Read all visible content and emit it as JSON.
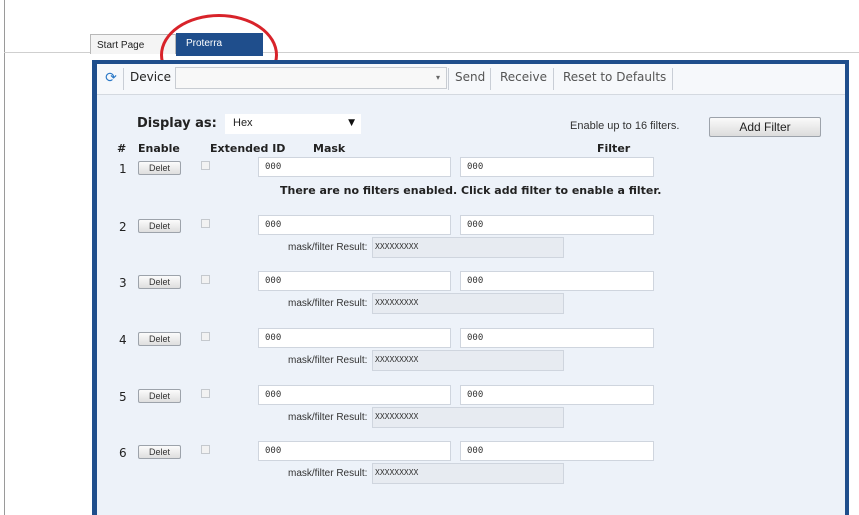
{
  "tabs": [
    {
      "label": "Start Page"
    },
    {
      "label": "Proterra"
    }
  ],
  "toolbar": {
    "device_label": "Device",
    "device_value": "",
    "send_label": "Send",
    "receive_label": "Receive",
    "reset_label": "Reset to Defaults"
  },
  "display": {
    "label": "Display as:",
    "selected": "Hex"
  },
  "enable_note": "Enable up to 16 filters.",
  "add_filter_label": "Add Filter",
  "columns": {
    "number": "#",
    "enable": "Enable",
    "extended_id": "Extended ID",
    "mask": "Mask",
    "filter": "Filter"
  },
  "no_filters_message": "There are no filters enabled. Click add filter to enable a filter.",
  "result_label": "mask/filter Result:",
  "rows": [
    {
      "num": "1",
      "delete_label": "Delet",
      "mask": "000",
      "filter": "000",
      "result": ""
    },
    {
      "num": "2",
      "delete_label": "Delet",
      "mask": "000",
      "filter": "000",
      "result": "XXXXXXXXX"
    },
    {
      "num": "3",
      "delete_label": "Delet",
      "mask": "000",
      "filter": "000",
      "result": "XXXXXXXXX"
    },
    {
      "num": "4",
      "delete_label": "Delet",
      "mask": "000",
      "filter": "000",
      "result": "XXXXXXXXX"
    },
    {
      "num": "5",
      "delete_label": "Delet",
      "mask": "000",
      "filter": "000",
      "result": "XXXXXXXXX"
    },
    {
      "num": "6",
      "delete_label": "Delet",
      "mask": "000",
      "filter": "000",
      "result": "XXXXXXXXX"
    }
  ],
  "colors": {
    "accent": "#1f4e8c",
    "panel_bg": "#edf2f9",
    "annotation_red": "#d8232a"
  },
  "icons": {
    "refresh": "refresh-icon"
  }
}
